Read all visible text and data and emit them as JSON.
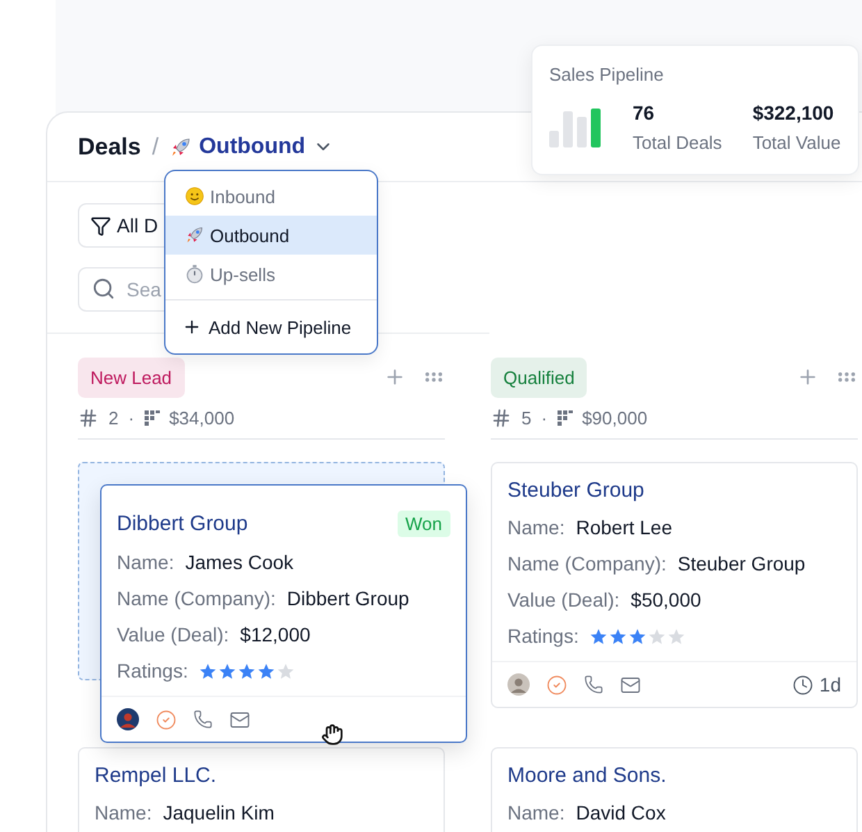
{
  "header": {
    "title": "Deals",
    "separator": "/",
    "pipeline": "Outbound"
  },
  "pipeline_menu": {
    "items": [
      {
        "kind": "smiley",
        "label": "Inbound",
        "selected": false
      },
      {
        "kind": "rocket",
        "label": "Outbound",
        "selected": true
      },
      {
        "kind": "stopwatch",
        "label": "Up-sells",
        "selected": false
      }
    ],
    "add_label": "Add New Pipeline"
  },
  "toolbar": {
    "filter_label": "All D",
    "search_placeholder": "Sea"
  },
  "summary": {
    "title": "Sales Pipeline",
    "stats": [
      {
        "value": "76",
        "label": "Total Deals"
      },
      {
        "value": "$322,100",
        "label": "Total Value"
      }
    ]
  },
  "columns": [
    {
      "name": "New Lead",
      "color": "#be185d",
      "count": "2",
      "separator": "·",
      "total": "$34,000",
      "cards": [
        {
          "title": "Dibbert Group",
          "badge": "Won",
          "dragging": true,
          "fields": [
            {
              "label": "Name:",
              "value": "James Cook"
            },
            {
              "label": "Name (Company):",
              "value": "Dibbert Group"
            },
            {
              "label": "Value (Deal):",
              "value": "$12,000"
            }
          ],
          "ratings_label": "Ratings:",
          "stars": 4
        },
        {
          "title": "Rempel LLC.",
          "dragging": false,
          "fields": [
            {
              "label": "Name:",
              "value": "Jaquelin Kim"
            }
          ]
        }
      ]
    },
    {
      "name": "Qualified",
      "color": "#15803d",
      "count": "5",
      "separator": "·",
      "total": "$90,000",
      "cards": [
        {
          "title": "Steuber Group",
          "dragging": false,
          "fields": [
            {
              "label": "Name:",
              "value": "Robert Lee"
            },
            {
              "label": "Name (Company):",
              "value": "Steuber Group"
            },
            {
              "label": "Value (Deal):",
              "value": "$50,000"
            }
          ],
          "ratings_label": "Ratings:",
          "stars": 3,
          "age": "1d"
        },
        {
          "title": "Moore and Sons.",
          "dragging": false,
          "fields": [
            {
              "label": "Name:",
              "value": "David Cox"
            }
          ]
        }
      ]
    }
  ]
}
